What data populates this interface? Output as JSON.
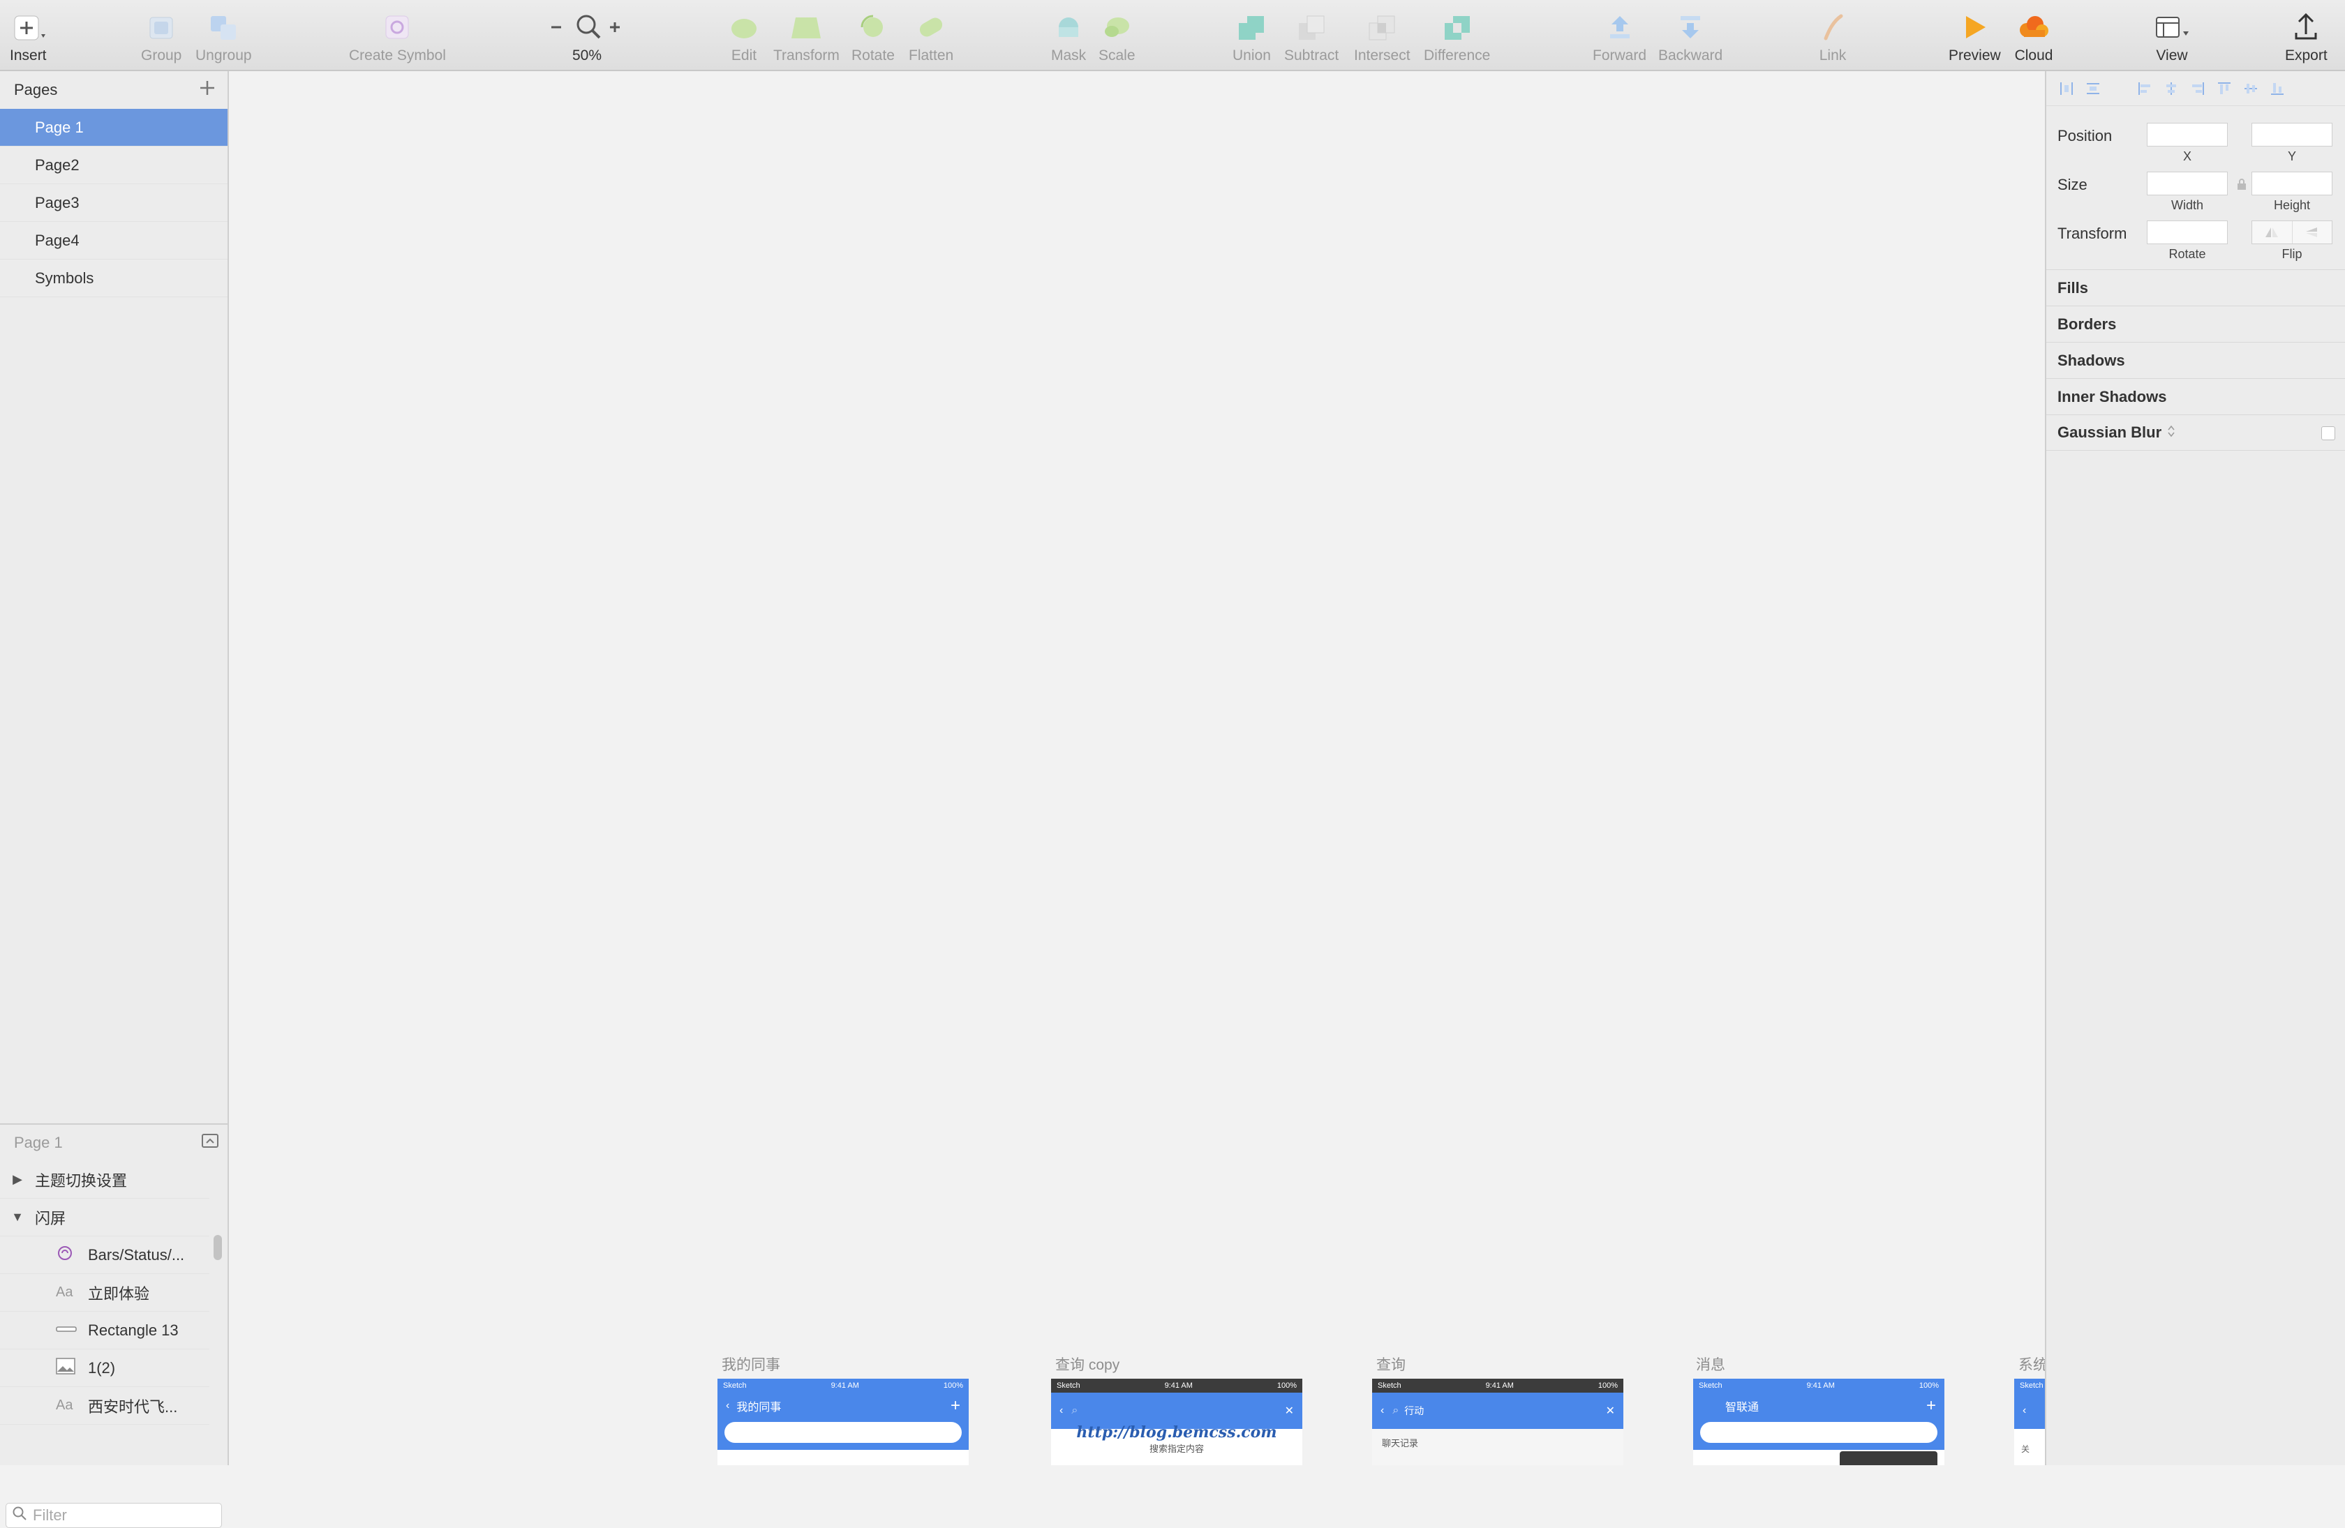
{
  "toolbar": {
    "insert": "Insert",
    "group": "Group",
    "ungroup": "Ungroup",
    "create_symbol": "Create Symbol",
    "zoom": "50%",
    "edit": "Edit",
    "transform": "Transform",
    "rotate": "Rotate",
    "flatten": "Flatten",
    "mask": "Mask",
    "scale": "Scale",
    "union": "Union",
    "subtract": "Subtract",
    "intersect": "Intersect",
    "difference": "Difference",
    "forward": "Forward",
    "backward": "Backward",
    "link": "Link",
    "preview": "Preview",
    "cloud": "Cloud",
    "view": "View",
    "export": "Export"
  },
  "pages": {
    "heading": "Pages",
    "items": [
      "Page 1",
      "Page2",
      "Page3",
      "Page4",
      "Symbols"
    ],
    "selected": "Page 1"
  },
  "layers": {
    "heading": "Page 1",
    "items": [
      {
        "label": "主题切换设置",
        "expanded": false
      },
      {
        "label": "闪屏",
        "expanded": true
      }
    ],
    "children": [
      {
        "label": "Bars/Status/...",
        "icon": "symbol-icon"
      },
      {
        "label": "立即体验",
        "icon": "text-icon"
      },
      {
        "label": "Rectangle 13",
        "icon": "rectangle-icon"
      },
      {
        "label": "1(2)",
        "icon": "image-icon"
      },
      {
        "label": "西安时代飞...",
        "icon": "text-icon"
      }
    ],
    "filter_placeholder": "Filter"
  },
  "canvas": {
    "artboards": [
      {
        "title": "我的同事",
        "nav": "我的同事",
        "time": "9:41 AM",
        "battery": "100%"
      },
      {
        "title": "查询 copy",
        "watermark": "http://blog.bemcss.com",
        "subtitle": "搜索指定内容",
        "time": "9:41 AM",
        "battery": "100%"
      },
      {
        "title": "查询",
        "nav": "行动",
        "row": "聊天记录",
        "time": "9:41 AM",
        "battery": "100%"
      },
      {
        "title": "消息",
        "nav": "智联通",
        "time": "9:41 AM",
        "battery": "100%"
      },
      {
        "title": "系统"
      }
    ],
    "carrier": "Sketch",
    "misc_label_1": "关"
  },
  "inspector": {
    "position": "Position",
    "x": "X",
    "y": "Y",
    "size": "Size",
    "width": "Width",
    "height": "Height",
    "transform": "Transform",
    "rotate": "Rotate",
    "flip": "Flip",
    "fills": "Fills",
    "borders": "Borders",
    "shadows": "Shadows",
    "inner_shadows": "Inner Shadows",
    "gaussian_blur": "Gaussian Blur"
  },
  "colors": {
    "selection": "#6b97de",
    "phone_nav": "#4a87ea",
    "preview_orange": "#f5a623",
    "cloud_orange": "#f06a1d"
  }
}
